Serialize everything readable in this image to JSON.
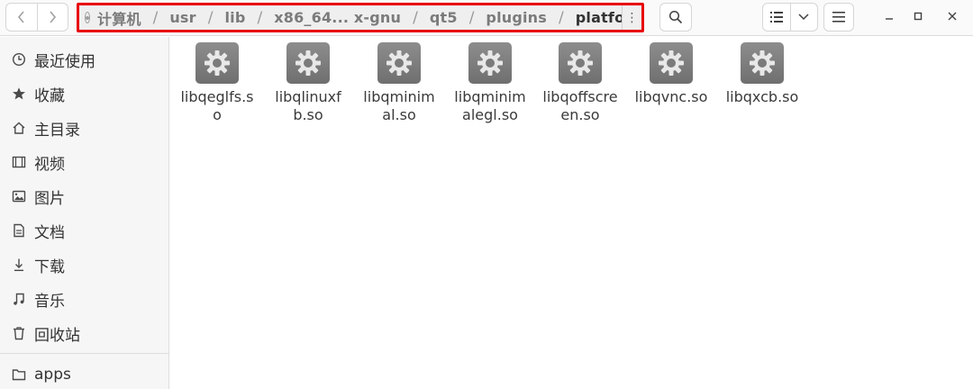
{
  "header": {
    "path": {
      "crumbs": [
        "计算机",
        "usr",
        "lib",
        "x86_64... x-gnu",
        "qt5",
        "plugins",
        "platforms"
      ],
      "separator": "/",
      "menu_glyph": "⋮"
    },
    "nav": {
      "back_icon": "chevron-left-icon",
      "forward_icon": "chevron-right-icon"
    },
    "buttons": {
      "search_icon": "search-icon",
      "view_icon": "list-view-icon",
      "view_dropdown_icon": "chevron-down-icon",
      "menu_icon": "hamburger-menu-icon"
    },
    "window_controls": {
      "minimize": "–",
      "maximize": "□",
      "close": "✕"
    },
    "highlight_color": "#e8000a"
  },
  "sidebar": {
    "items": [
      {
        "label": "最近使用",
        "icon": "clock-icon"
      },
      {
        "label": "收藏",
        "icon": "star-icon"
      },
      {
        "label": "主目录",
        "icon": "home-icon"
      },
      {
        "label": "视频",
        "icon": "film-icon"
      },
      {
        "label": "图片",
        "icon": "image-icon"
      },
      {
        "label": "文档",
        "icon": "document-icon"
      },
      {
        "label": "下载",
        "icon": "download-icon"
      },
      {
        "label": "音乐",
        "icon": "music-icon"
      },
      {
        "label": "回收站",
        "icon": "trash-icon"
      },
      {
        "label": "apps",
        "icon": "folder-icon"
      }
    ]
  },
  "files": [
    {
      "name": "libqeglfs.so",
      "icon": "gear-icon"
    },
    {
      "name": "libqlinuxfb.so",
      "icon": "gear-icon"
    },
    {
      "name": "libqminimal.so",
      "icon": "gear-icon"
    },
    {
      "name": "libqminimalegl.so",
      "icon": "gear-icon"
    },
    {
      "name": "libqoffscreen.so",
      "icon": "gear-icon"
    },
    {
      "name": "libqvnc.so",
      "icon": "gear-icon"
    },
    {
      "name": "libqxcb.so",
      "icon": "gear-icon"
    }
  ]
}
